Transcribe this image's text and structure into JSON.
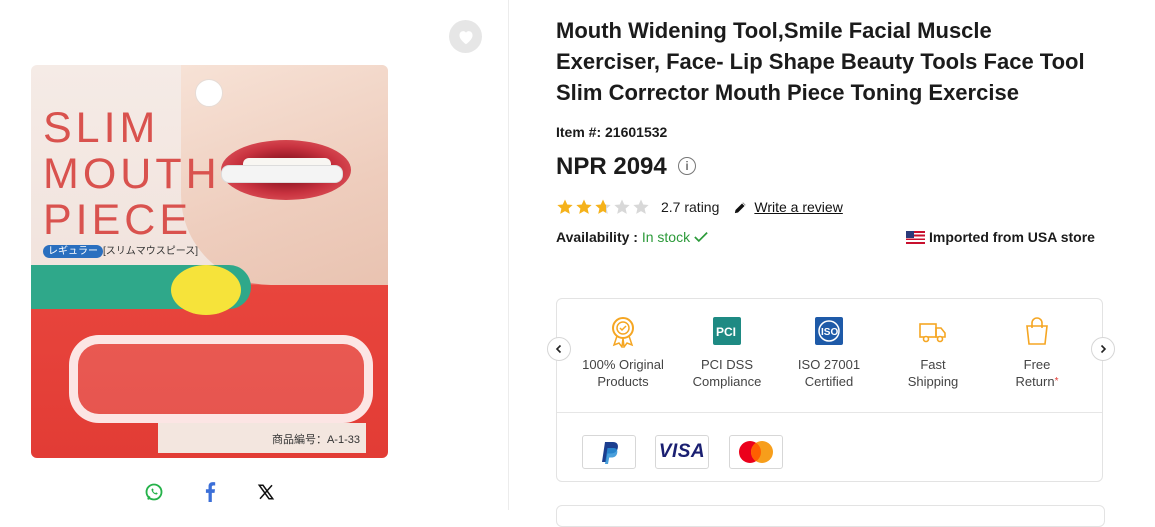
{
  "product": {
    "title": "Mouth Widening Tool,Smile Facial Muscle Exerciser, Face- Lip Shape Beauty Tools Face Tool Slim Corrector Mouth Piece Toning Exercise",
    "item_label": "Item #:",
    "item_number": "21601532",
    "price": "NPR 2094",
    "rating_value": 2.7,
    "rating_max": 5,
    "rating_text": "2.7 rating",
    "write_review": "Write a review",
    "availability_label": "Availability :",
    "availability_value": "In stock",
    "imported_text": "Imported from USA store"
  },
  "image": {
    "package_text": [
      "SLIM",
      "MOUTH",
      "PIECE"
    ],
    "package_tag": "レギュラー",
    "package_sub": "[スリムマウスピース]",
    "package_bottom": "商品編号：A-1-33"
  },
  "share": [
    {
      "name": "whatsapp-icon"
    },
    {
      "name": "facebook-icon"
    },
    {
      "name": "x-icon"
    }
  ],
  "features": [
    {
      "line1": "100% Original",
      "line2": "Products",
      "icon": "badge-icon"
    },
    {
      "line1": "PCI DSS",
      "line2": "Compliance",
      "icon": "pci-icon"
    },
    {
      "line1": "ISO 27001",
      "line2": "Certified",
      "icon": "iso-icon"
    },
    {
      "line1": "Fast",
      "line2": "Shipping",
      "icon": "truck-icon"
    },
    {
      "line1": "Free",
      "line2": "Return",
      "icon": "bag-icon"
    }
  ],
  "payments": [
    "PayPal",
    "VISA",
    "Mastercard"
  ],
  "colors": {
    "accent_orange": "#f5a623",
    "stock_green": "#2c9a3a",
    "star_gold": "#f5b21b",
    "star_empty": "#d8d8d8",
    "iso_blue": "#1e5aa8",
    "pci_teal": "#1e8a83"
  }
}
